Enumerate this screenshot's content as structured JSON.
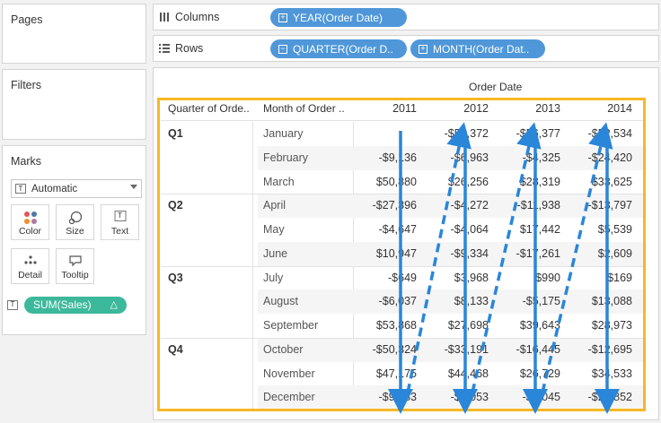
{
  "left_panel": {
    "pages_title": "Pages",
    "filters_title": "Filters",
    "marks": {
      "title": "Marks",
      "mark_type": "Automatic",
      "buttons": [
        {
          "label": "Color",
          "icon": "color-dots-icon"
        },
        {
          "label": "Size",
          "icon": "size-icon"
        },
        {
          "label": "Text",
          "icon": "text-icon"
        },
        {
          "label": "Detail",
          "icon": "detail-dots-icon"
        },
        {
          "label": "Tooltip",
          "icon": "tooltip-icon"
        }
      ],
      "field_pill": {
        "label": "SUM(Sales)",
        "suffix": "△"
      }
    }
  },
  "shelves": {
    "columns": {
      "label": "Columns",
      "pills": [
        {
          "label": "YEAR(Order Date)"
        }
      ]
    },
    "rows": {
      "label": "Rows",
      "pills": [
        {
          "label": "QUARTER(Order D.."
        },
        {
          "label": "MONTH(Order Dat.."
        }
      ]
    }
  },
  "viz": {
    "column_header_title": "Order Date",
    "row_headers": [
      "Quarter of Orde..",
      "Month of Order .."
    ],
    "years": [
      "2011",
      "2012",
      "2013",
      "2014"
    ],
    "quarters": [
      "Q1",
      "Q2",
      "Q3",
      "Q4"
    ],
    "months": [
      "January",
      "February",
      "March",
      "April",
      "May",
      "June",
      "July",
      "August",
      "September",
      "October",
      "November",
      "December"
    ],
    "values": [
      [
        "",
        "-$51,372",
        "-$56,377",
        "-$52,534"
      ],
      [
        "-$9,136",
        "-$6,963",
        "-$4,325",
        "-$24,420"
      ],
      [
        "$50,880",
        "$26,256",
        "$28,319",
        "$33,625"
      ],
      [
        "-$27,396",
        "-$4,272",
        "-$11,938",
        "-$13,797"
      ],
      [
        "-$4,647",
        "-$4,064",
        "$17,442",
        "$5,539"
      ],
      [
        "$10,947",
        "-$9,334",
        "-$17,261",
        "$2,609"
      ],
      [
        "-$649",
        "$3,968",
        "$990",
        "$169"
      ],
      [
        "-$6,037",
        "$8,133",
        "-$5,175",
        "$13,088"
      ],
      [
        "$53,868",
        "$27,698",
        "$39,643",
        "$28,973"
      ],
      [
        "-$50,324",
        "-$33,191",
        "-$16,445",
        "-$12,695"
      ],
      [
        "$47,175",
        "$44,468",
        "$26,729",
        "$34,533"
      ],
      [
        "-$9,083",
        "-$1,053",
        "-$1,045",
        "-$21,852"
      ]
    ],
    "colors": {
      "highlight": "#f6b826",
      "arrow": "#2a86d9",
      "pill_blue": "#4f97d9",
      "pill_green": "#3cb89b"
    }
  }
}
